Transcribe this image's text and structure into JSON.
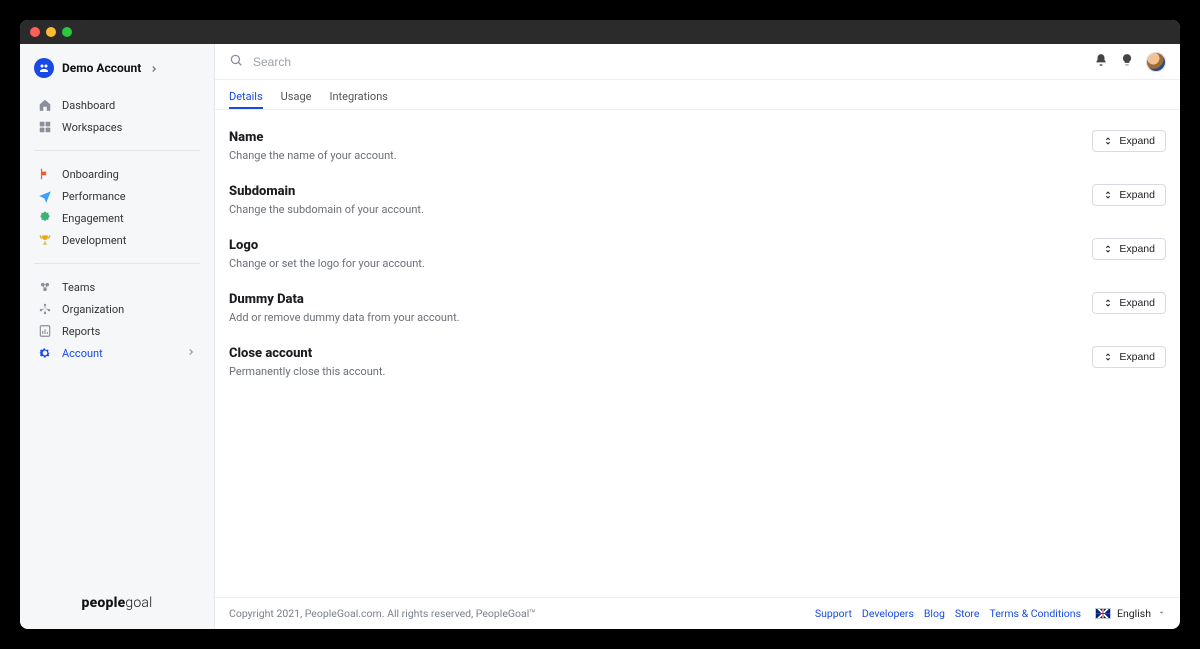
{
  "sidebar": {
    "account_label": "Demo Account",
    "groups": [
      {
        "items": [
          {
            "label": "Dashboard",
            "icon": "home"
          },
          {
            "label": "Workspaces",
            "icon": "grid"
          }
        ]
      },
      {
        "items": [
          {
            "label": "Onboarding",
            "icon": "flag"
          },
          {
            "label": "Performance",
            "icon": "plane"
          },
          {
            "label": "Engagement",
            "icon": "puzzle"
          },
          {
            "label": "Development",
            "icon": "trophy"
          }
        ]
      },
      {
        "items": [
          {
            "label": "Teams",
            "icon": "teams"
          },
          {
            "label": "Organization",
            "icon": "org"
          },
          {
            "label": "Reports",
            "icon": "reports"
          },
          {
            "label": "Account",
            "icon": "gear",
            "active": true,
            "chevron": true
          }
        ]
      }
    ],
    "brand1": "people",
    "brand2": "goal"
  },
  "topbar": {
    "search_placeholder": "Search"
  },
  "tabs": [
    {
      "label": "Details",
      "active": true
    },
    {
      "label": "Usage"
    },
    {
      "label": "Integrations"
    }
  ],
  "sections": [
    {
      "title": "Name",
      "desc": "Change the name of your account.",
      "button": "Expand"
    },
    {
      "title": "Subdomain",
      "desc": "Change the subdomain of your account.",
      "button": "Expand"
    },
    {
      "title": "Logo",
      "desc": "Change or set the logo for your account.",
      "button": "Expand"
    },
    {
      "title": "Dummy Data",
      "desc": "Add or remove dummy data from your account.",
      "button": "Expand"
    },
    {
      "title": "Close account",
      "desc": "Permanently close this account.",
      "button": "Expand"
    }
  ],
  "footer": {
    "copyright": "Copyright 2021, PeopleGoal.com. All rights reserved, PeopleGoal™",
    "links": [
      "Support",
      "Developers",
      "Blog",
      "Store",
      "Terms & Conditions"
    ],
    "language": "English"
  }
}
